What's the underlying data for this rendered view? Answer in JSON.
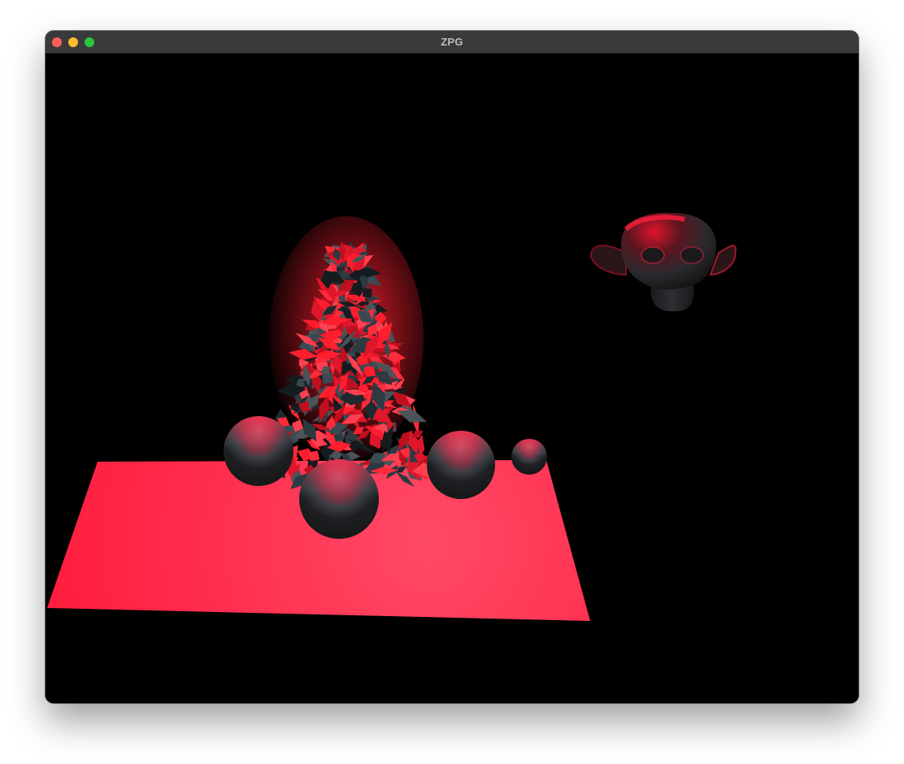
{
  "window": {
    "title": "ZPG",
    "controls": [
      {
        "name": "close",
        "color": "#ff5f57"
      },
      {
        "name": "minimize",
        "color": "#febc2e"
      },
      {
        "name": "zoom",
        "color": "#28c840"
      }
    ]
  },
  "scene": {
    "background_color": "#000000",
    "light_color": "#ff1e3c",
    "objects": [
      "plane",
      "tree",
      "sphere",
      "sphere",
      "sphere",
      "sphere",
      "monkey-head"
    ]
  }
}
